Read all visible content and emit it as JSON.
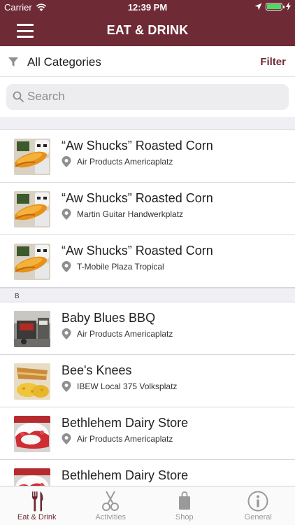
{
  "status_bar": {
    "carrier": "Carrier",
    "time": "12:39 PM"
  },
  "nav": {
    "title": "EAT & DRINK",
    "menu_icon": "hamburger-icon"
  },
  "category_bar": {
    "label": "All Categories",
    "filter_label": "Filter"
  },
  "search": {
    "placeholder": "Search"
  },
  "sections": [
    {
      "header": "",
      "items": [
        {
          "name": "“Aw Shucks” Roasted Corn",
          "location": "Air Products Americaplatz",
          "thumb": "corn"
        },
        {
          "name": "“Aw Shucks” Roasted Corn",
          "location": "Martin Guitar Handwerkplatz",
          "thumb": "corn"
        },
        {
          "name": "“Aw Shucks” Roasted Corn",
          "location": "T-Mobile Plaza Tropical",
          "thumb": "corn"
        }
      ]
    },
    {
      "header": "B",
      "items": [
        {
          "name": "Baby Blues BBQ",
          "location": "Air Products Americaplatz",
          "thumb": "bbq"
        },
        {
          "name": "Bee's Knees",
          "location": "IBEW Local 375 Volksplatz",
          "thumb": "sandwich"
        },
        {
          "name": "Bethlehem Dairy Store",
          "location": "Air Products Americaplatz",
          "thumb": "strawberry"
        },
        {
          "name": "Bethlehem Dairy Store",
          "location": "",
          "thumb": "strawberry"
        }
      ]
    }
  ],
  "tabs": [
    {
      "label": "Eat & Drink",
      "icon": "fork-knife-icon",
      "active": true
    },
    {
      "label": "Activities",
      "icon": "scissors-icon",
      "active": false
    },
    {
      "label": "Shop",
      "icon": "shopping-bag-icon",
      "active": false
    },
    {
      "label": "General",
      "icon": "info-icon",
      "active": false
    }
  ],
  "colors": {
    "brand": "#6e2b35",
    "battery": "#4cd964",
    "inactive_tab": "#999999"
  }
}
